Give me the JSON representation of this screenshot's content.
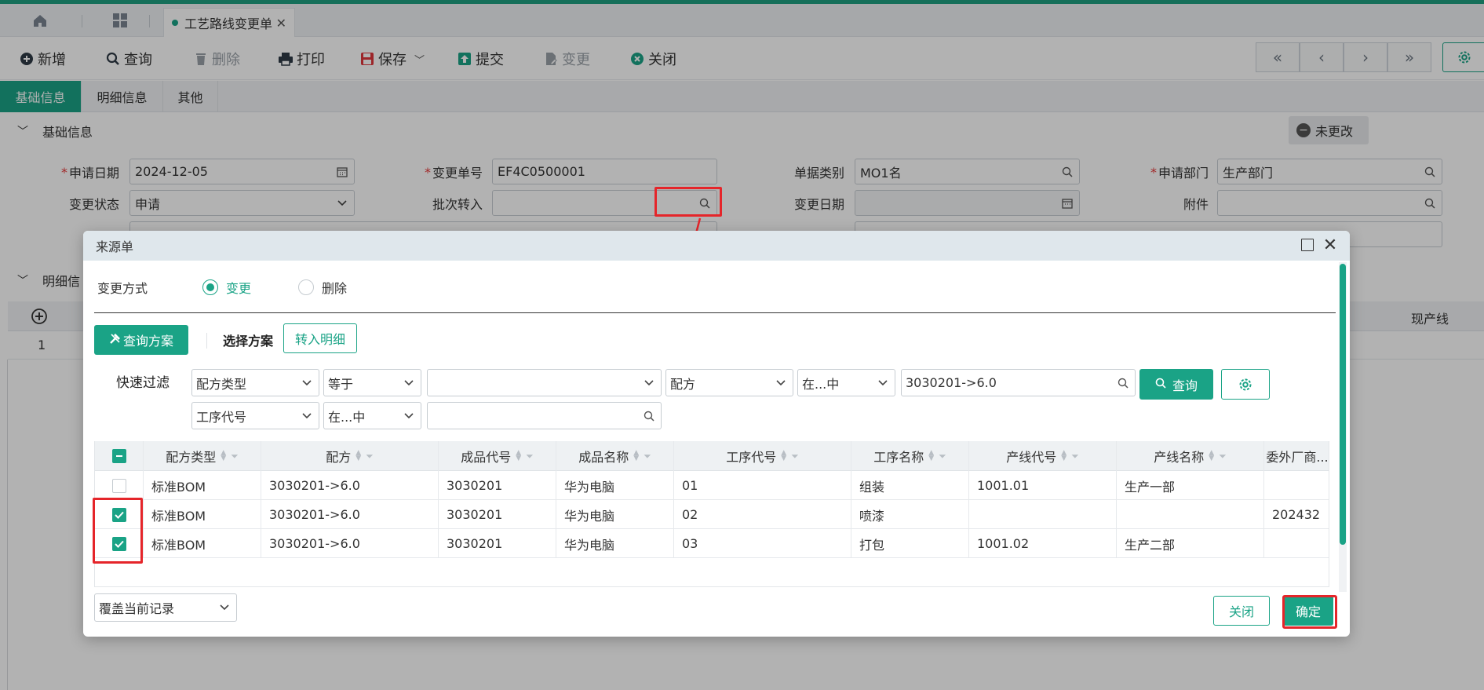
{
  "app": {
    "tab_title": "工艺路线变更单"
  },
  "toolbar": {
    "new_label": "新增",
    "query_label": "查询",
    "delete_label": "删除",
    "print_label": "打印",
    "save_label": "保存",
    "submit_label": "提交",
    "change_label": "变更",
    "close_label": "关闭",
    "nav_first": "«",
    "nav_prev": "‹",
    "nav_next": "›",
    "nav_last": "»"
  },
  "subtabs": [
    "基础信息",
    "明细信息",
    "其他"
  ],
  "basic_section": {
    "title": "基础信息",
    "status_badge": "未更改",
    "fields": {
      "apply_date_label": "申请日期",
      "apply_date_value": "2024-12-05",
      "change_no_label": "变更单号",
      "change_no_value": "EF4C0500001",
      "doc_type_label": "单据类别",
      "doc_type_value": "MO1名",
      "apply_dept_label": "申请部门",
      "apply_dept_value": "生产部门",
      "change_status_label": "变更状态",
      "change_status_value": "申请",
      "batch_transfer_label": "批次转入",
      "batch_transfer_value": "",
      "change_date_label": "变更日期",
      "change_date_value": "",
      "attachment_label": "附件",
      "attachment_value": ""
    }
  },
  "detail_section": {
    "title": "明细信",
    "col_right": "现产线",
    "row_index": "1"
  },
  "dialog": {
    "title": "来源单",
    "mode_label": "变更方式",
    "mode_options": [
      {
        "label": "变更",
        "selected": true
      },
      {
        "label": "删除",
        "selected": false
      }
    ],
    "scheme_button": "查询方案",
    "select_scheme_label": "选择方案",
    "transfer_button": "转入明细",
    "quick_filter_label": "快速过滤",
    "filters": {
      "row1": {
        "field": "配方类型",
        "op": "等于",
        "value": "",
        "field2": "配方",
        "op2": "在...中",
        "value2": "3030201->6.0"
      },
      "row2": {
        "field": "工序代号",
        "op": "在...中",
        "value": ""
      }
    },
    "query_button": "查询",
    "grid": {
      "columns": [
        "配方类型",
        "配方",
        "成品代号",
        "成品名称",
        "工序代号",
        "工序名称",
        "产线代号",
        "产线名称",
        "委外厂商..."
      ],
      "rows": [
        {
          "checked": false,
          "cells": [
            "标准BOM",
            "3030201->6.0",
            "3030201",
            "华为电脑",
            "01",
            "组装",
            "1001.01",
            "生产一部",
            ""
          ]
        },
        {
          "checked": true,
          "cells": [
            "标准BOM",
            "3030201->6.0",
            "3030201",
            "华为电脑",
            "02",
            "喷漆",
            "",
            "",
            "202432"
          ]
        },
        {
          "checked": true,
          "cells": [
            "标准BOM",
            "3030201->6.0",
            "3030201",
            "华为电脑",
            "03",
            "打包",
            "1001.02",
            "生产二部",
            ""
          ]
        }
      ]
    },
    "cover_mode": "覆盖当前记录",
    "close_button": "关闭",
    "confirm_button": "确定"
  },
  "colors": {
    "accent": "#1aa386",
    "highlight": "#e5252a"
  }
}
